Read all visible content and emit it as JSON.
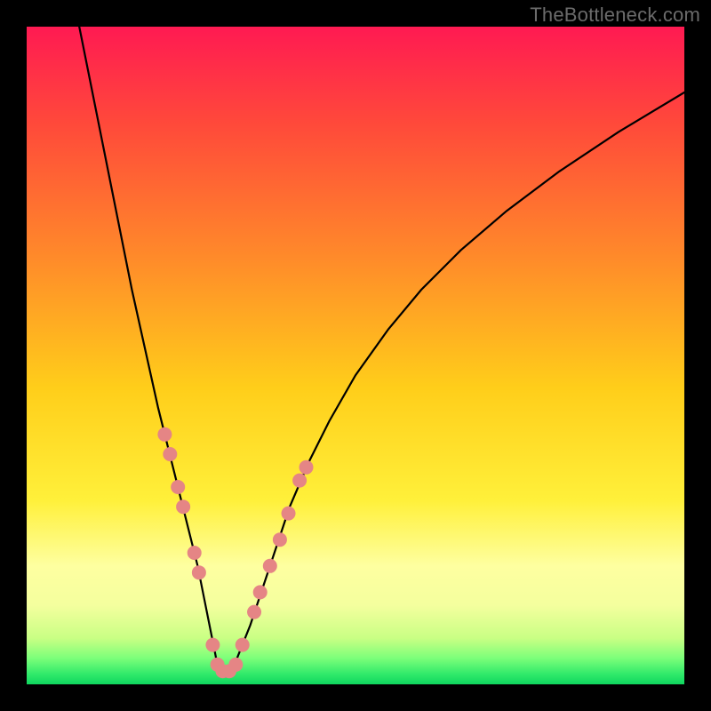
{
  "watermark": "TheBottleneck.com",
  "chart_data": {
    "type": "line",
    "title": "",
    "xlabel": "",
    "ylabel": "",
    "xlim": [
      0,
      100
    ],
    "ylim": [
      0,
      100
    ],
    "grid": false,
    "legend": false,
    "gradient_stops": [
      {
        "offset": 0.0,
        "color": "#ff1a52"
      },
      {
        "offset": 0.15,
        "color": "#ff4a3a"
      },
      {
        "offset": 0.35,
        "color": "#ff8a2a"
      },
      {
        "offset": 0.55,
        "color": "#ffce1a"
      },
      {
        "offset": 0.72,
        "color": "#fff03a"
      },
      {
        "offset": 0.82,
        "color": "#feffa0"
      },
      {
        "offset": 0.88,
        "color": "#f4ff9e"
      },
      {
        "offset": 0.93,
        "color": "#c9ff84"
      },
      {
        "offset": 0.96,
        "color": "#7dff7a"
      },
      {
        "offset": 0.985,
        "color": "#2fe96a"
      },
      {
        "offset": 1.0,
        "color": "#0fd65e"
      }
    ],
    "series": [
      {
        "name": "bottleneck-curve",
        "color": "#000000",
        "stroke_width": 2.2,
        "x": [
          8,
          10,
          12,
          14,
          16,
          18,
          20,
          22,
          24,
          26,
          27,
          28,
          28.8,
          29.5,
          30.5,
          32,
          34,
          36,
          38,
          40,
          43,
          46,
          50,
          55,
          60,
          66,
          73,
          81,
          90,
          100
        ],
        "y": [
          100,
          90,
          80,
          70,
          60,
          51,
          42,
          34,
          26,
          18,
          13,
          8,
          4,
          2,
          2,
          4,
          9,
          15,
          21,
          27,
          34,
          40,
          47,
          54,
          60,
          66,
          72,
          78,
          84,
          90
        ]
      }
    ],
    "markers": {
      "name": "highlight-dots",
      "color": "#e58585",
      "radius": 8,
      "points": [
        {
          "x": 21.0,
          "y": 38
        },
        {
          "x": 21.8,
          "y": 35
        },
        {
          "x": 23.0,
          "y": 30
        },
        {
          "x": 23.8,
          "y": 27
        },
        {
          "x": 25.5,
          "y": 20
        },
        {
          "x": 26.2,
          "y": 17
        },
        {
          "x": 28.3,
          "y": 6
        },
        {
          "x": 29.0,
          "y": 3
        },
        {
          "x": 29.8,
          "y": 2
        },
        {
          "x": 30.8,
          "y": 2
        },
        {
          "x": 31.8,
          "y": 3
        },
        {
          "x": 32.8,
          "y": 6
        },
        {
          "x": 34.6,
          "y": 11
        },
        {
          "x": 35.5,
          "y": 14
        },
        {
          "x": 37.0,
          "y": 18
        },
        {
          "x": 38.5,
          "y": 22
        },
        {
          "x": 39.8,
          "y": 26
        },
        {
          "x": 41.5,
          "y": 31
        },
        {
          "x": 42.5,
          "y": 33
        }
      ]
    }
  }
}
